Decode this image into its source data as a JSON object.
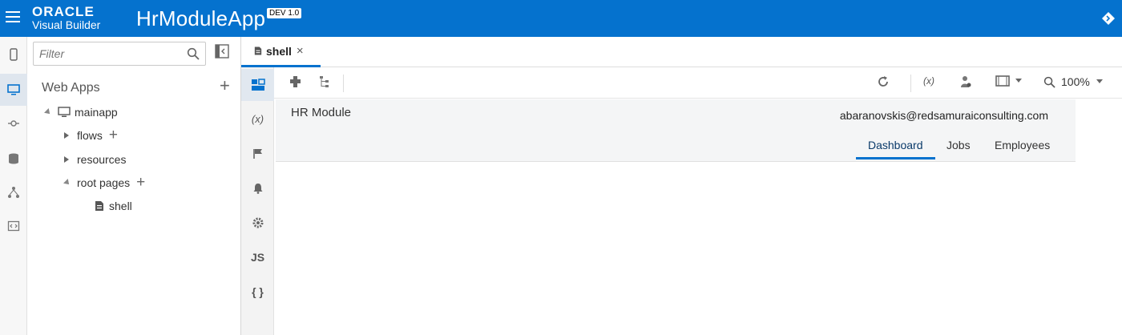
{
  "header": {
    "brand_line1": "ORACLE",
    "brand_line2": "Visual Builder",
    "app_title": "HrModuleApp",
    "version_badge": "DEV 1.0",
    "bg_color": "#0572ce"
  },
  "rail": {
    "icons": [
      "mobile-apps-icon",
      "web-apps-icon",
      "services-icon",
      "business-objects-icon",
      "processes-icon",
      "source-view-icon"
    ]
  },
  "navigator": {
    "filter_placeholder": "Filter",
    "section_title": "Web Apps",
    "tree": {
      "app": "mainapp",
      "flows": "flows",
      "resources": "resources",
      "root_pages": "root pages",
      "shell": "shell"
    }
  },
  "editor": {
    "tab_label": "shell",
    "tab_close": "×",
    "side_tools": [
      "page-designer-icon",
      "variables-icon",
      "actions-icon",
      "events-icon",
      "settings-icon",
      "JS",
      "{ }"
    ],
    "zoom": "100%"
  },
  "preview": {
    "app_name": "HR Module",
    "user": "abaranovskis@redsamuraiconsulting.com",
    "tabs": [
      "Dashboard",
      "Jobs",
      "Employees"
    ],
    "selected_tab": "Dashboard"
  }
}
